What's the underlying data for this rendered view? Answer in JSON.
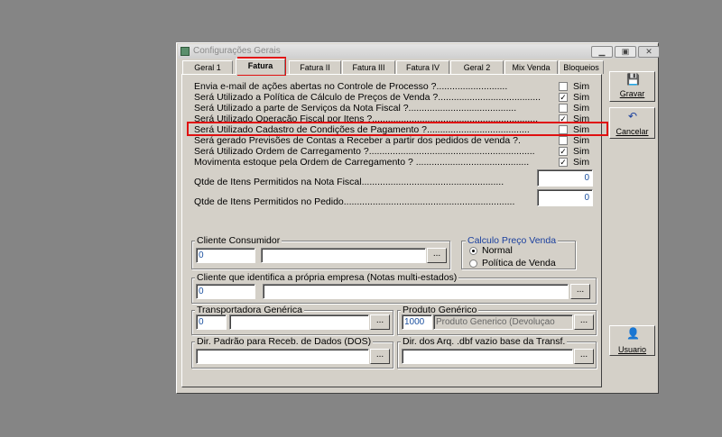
{
  "window": {
    "title": "Configurações Gerais"
  },
  "tabs": [
    {
      "label": "Geral 1"
    },
    {
      "label": "Fatura"
    },
    {
      "label": "Fatura II"
    },
    {
      "label": "Fatura III"
    },
    {
      "label": "Fatura IV"
    },
    {
      "label": "Geral 2"
    },
    {
      "label": "Mix Venda"
    },
    {
      "label": "Bloqueios"
    }
  ],
  "options": [
    {
      "label": "Envia e-mail de ações abertas no Controle de Processo ?...........................",
      "checked": false,
      "value": "Sim"
    },
    {
      "label": "Será Utilizado a Política de Cálculo de Preços de Venda ?.......................................",
      "checked": true,
      "value": "Sim"
    },
    {
      "label": "Será Utilizado a parte de Serviços da Nota Fiscal ?.........................................",
      "checked": false,
      "value": "Sim"
    },
    {
      "label": "Será Utilizado Operação Fiscal por Itens ?...............................................................",
      "checked": true,
      "value": "Sim"
    },
    {
      "label": "Será Utilizado Cadastro de Condições de Pagamento ?.......................................",
      "checked": false,
      "value": "Sim"
    },
    {
      "label": "Será gerado Previsões de Contas a Receber a partir dos pedidos de venda ?.",
      "checked": false,
      "value": "Sim"
    },
    {
      "label": "Será Utilizado Ordem de Carregamento ?...............................................................",
      "checked": true,
      "value": "Sim"
    },
    {
      "label": "Movimenta estoque pela Ordem de Carregamento ? ...........................................",
      "checked": true,
      "value": "Sim"
    }
  ],
  "limits": {
    "nota_label": "Qtde de Itens Permitidos na Nota Fiscal......................................................",
    "nota_value": "0",
    "pedido_label": "Qtde de Itens Permitidos no Pedido.................................................................",
    "pedido_value": "0"
  },
  "cliente_consumidor": {
    "label": "Cliente Consumidor",
    "code": "0",
    "name": "",
    "button": "..."
  },
  "calculo": {
    "label": "Calculo Preço Venda",
    "options": [
      "Normal",
      "Política de Venda"
    ],
    "selected": "Normal"
  },
  "cliente_empresa": {
    "label": "Cliente que identifica a própria empresa (Notas multi-estados)",
    "code": "0",
    "name": "",
    "button": "..."
  },
  "transportadora": {
    "label": "Transportadora Genérica",
    "code": "0",
    "name": "",
    "button": "..."
  },
  "produto": {
    "label": "Produto Genérico",
    "code": "1000",
    "name": "Produto Generico (Devoluçao",
    "button": "..."
  },
  "dir_dados": {
    "label": "Dir. Padrão para Receb. de Dados (DOS)",
    "value": "",
    "button": "..."
  },
  "dir_dbf": {
    "label": "Dir. dos Arq. .dbf vazio base da Transf.",
    "value": "",
    "button": "..."
  },
  "side_buttons": {
    "gravar": "Gravar",
    "cancelar": "Cancelar",
    "usuario": "Usuario"
  },
  "icons": {
    "gravar": "floppy-disk-icon",
    "cancelar": "undo-arrow-icon",
    "usuario": "user-icon"
  },
  "colors": {
    "highlight": "#e01010",
    "field_text": "#1a4f9e",
    "background": "#858585"
  }
}
